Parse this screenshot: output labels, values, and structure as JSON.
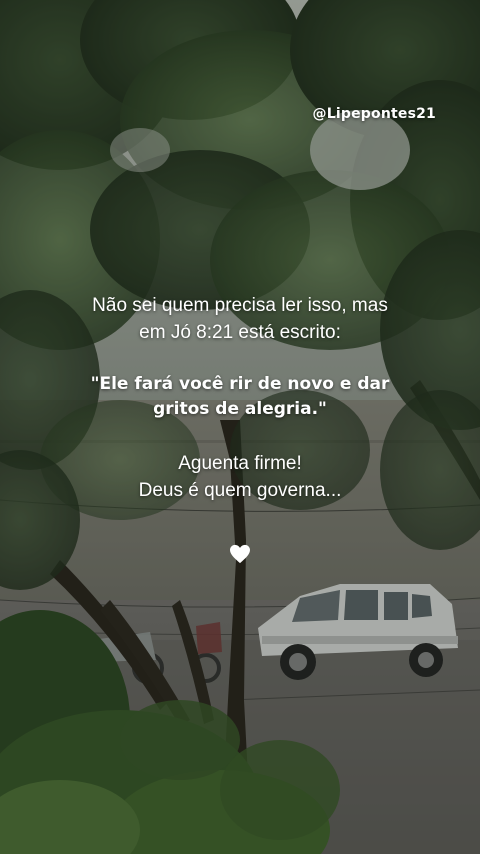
{
  "handle": "@Lipepontes21",
  "intro": {
    "line1": "Não sei quem precisa ler isso, mas",
    "line2": "em Jó 8:21 está escrito:"
  },
  "quote": {
    "line1": "\"Ele fará você rir de novo e dar",
    "line2": "gritos de alegria.\""
  },
  "outro": {
    "line1": "Aguenta firme!",
    "line2": "Deus é quem governa..."
  },
  "icons": {
    "heart": "white-heart-icon"
  },
  "colors": {
    "text": "#ffffff",
    "foliage_dark": "#2b3a26",
    "foliage_mid": "#4b6440",
    "wall": "#8c8b80",
    "street": "#6d6a66",
    "car": "#e8e8e6"
  }
}
